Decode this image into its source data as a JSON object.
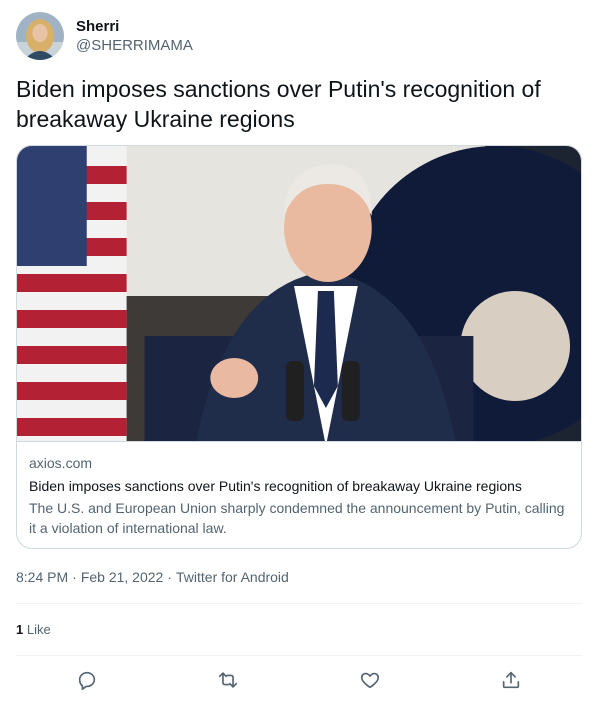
{
  "author": {
    "display_name": "Sherri",
    "handle": "@SHERRIMAMA"
  },
  "tweet": {
    "text": "Biden imposes sanctions over Putin's recognition of breakaway Ukraine regions"
  },
  "card": {
    "domain": "axios.com",
    "title": "Biden imposes sanctions over Putin's recognition of breakaway Ukraine regions",
    "description": "The U.S. and European Union sharply condemned the announcement by Putin, calling it a violation of international law."
  },
  "meta": {
    "time": "8:24 PM",
    "sep1": "·",
    "date": "Feb 21, 2022",
    "sep2": "·",
    "source": "Twitter for Android"
  },
  "stats": {
    "like_count": "1",
    "like_label": "Like"
  },
  "actions": [
    "reply-icon",
    "retweet-icon",
    "like-icon",
    "share-icon"
  ],
  "colors": {
    "text": "#0f1419",
    "secondary": "#536471",
    "border": "#cfd9de"
  }
}
